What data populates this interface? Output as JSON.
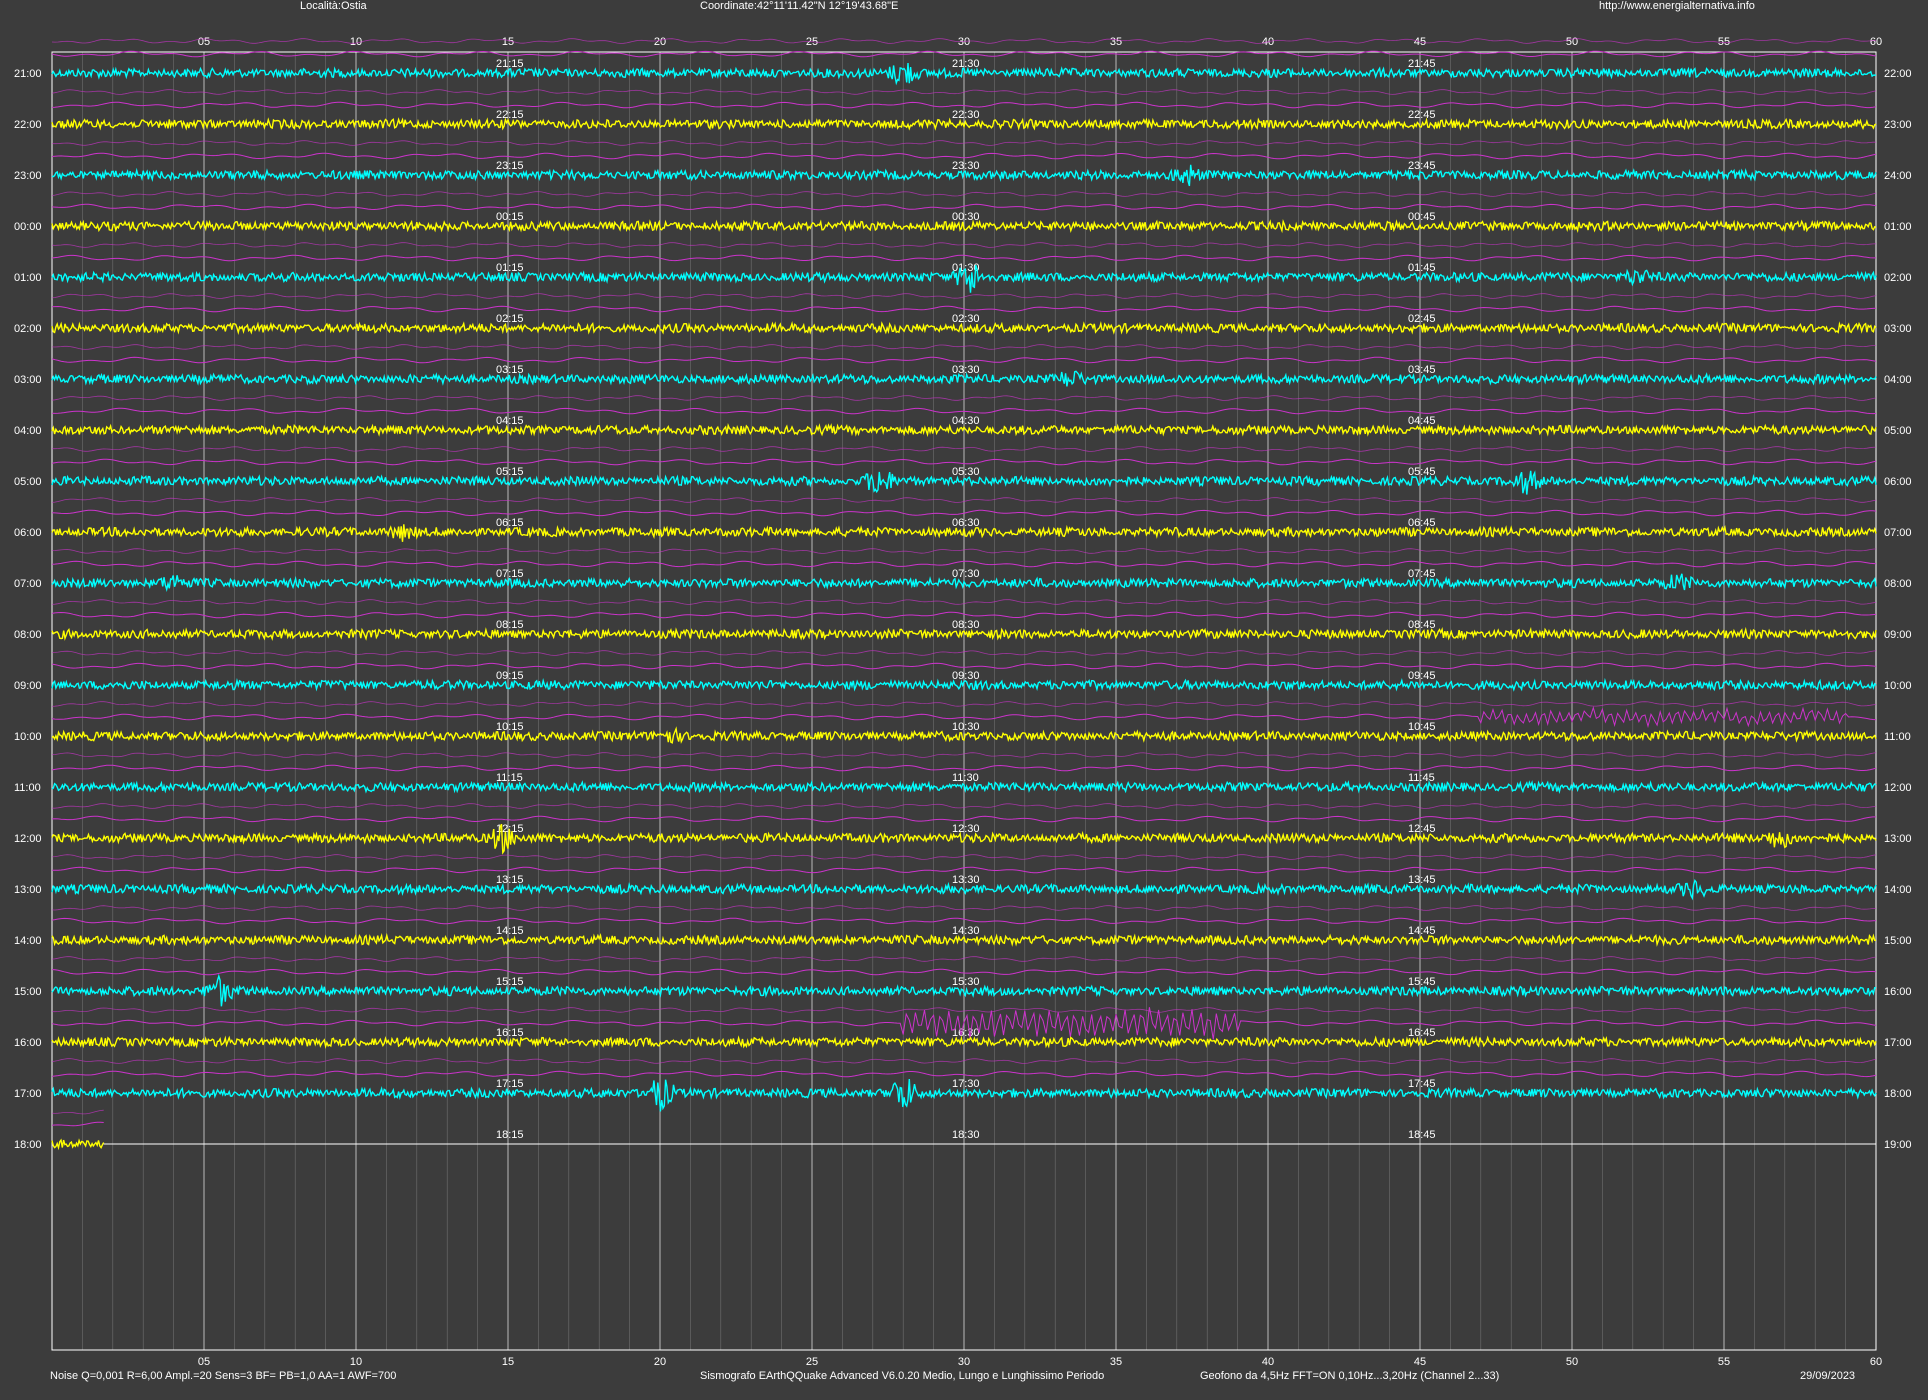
{
  "header": {
    "location": "Località:Ostia",
    "coordinates": "Coordinate:42°11'11.42\"N  12°19'43.68\"E",
    "website": "http://www.energialternativa.info"
  },
  "footer": {
    "settings": "Noise Q=0,001 R=6,00 Ampl.=20 Sens=3 BF= PB=1,0 AA=1 AWF=700",
    "software": "Sismografo  EArthQQuake Advanced V6.0.20  Medio, Lungo e Lunghissimo Periodo",
    "sensor": "Geofono da 4,5Hz FFT=ON 0,10Hz...3,20Hz      (Channel 2...33)",
    "date": "29/09/2023"
  },
  "colors": {
    "background": "#3c3c3c",
    "grid": "#9a9a9a",
    "frame": "#ffffff",
    "trace_a": "#00ffff",
    "trace_b": "#ffff00",
    "long_period": "#cc33cc",
    "text": "#ffffff"
  },
  "chart_data": {
    "type": "line",
    "x_unit": "minutes",
    "xlim": [
      0,
      60
    ],
    "x_ticks": [
      "05",
      "10",
      "15",
      "20",
      "25",
      "30",
      "35",
      "40",
      "45",
      "50",
      "55",
      "60"
    ],
    "grid": true,
    "rows_left_labels": [
      "21:00",
      "22:00",
      "23:00",
      "00:00",
      "01:00",
      "02:00",
      "03:00",
      "04:00",
      "05:00",
      "06:00",
      "07:00",
      "08:00",
      "09:00",
      "10:00",
      "11:00",
      "12:00",
      "13:00",
      "14:00",
      "15:00",
      "16:00",
      "17:00",
      "18:00"
    ],
    "rows_right_labels": [
      "22:00",
      "23:00",
      "24:00",
      "01:00",
      "02:00",
      "03:00",
      "04:00",
      "05:00",
      "06:00",
      "07:00",
      "08:00",
      "09:00",
      "10:00",
      "11:00",
      "12:00",
      "13:00",
      "14:00",
      "15:00",
      "16:00",
      "17:00",
      "18:00",
      "19:00"
    ],
    "quarter_labels": [
      [
        "21:15",
        "21:30",
        "21:45"
      ],
      [
        "22:15",
        "22:30",
        "22:45"
      ],
      [
        "23:15",
        "23:30",
        "23:45"
      ],
      [
        "00:15",
        "00:30",
        "00:45"
      ],
      [
        "01:15",
        "01:30",
        "01:45"
      ],
      [
        "02:15",
        "02:30",
        "02:45"
      ],
      [
        "03:15",
        "03:30",
        "03:45"
      ],
      [
        "04:15",
        "04:30",
        "04:45"
      ],
      [
        "05:15",
        "05:30",
        "05:45"
      ],
      [
        "06:15",
        "06:30",
        "06:45"
      ],
      [
        "07:15",
        "07:30",
        "07:45"
      ],
      [
        "08:15",
        "08:30",
        "08:45"
      ],
      [
        "09:15",
        "09:30",
        "09:45"
      ],
      [
        "10:15",
        "10:30",
        "10:45"
      ],
      [
        "11:15",
        "11:30",
        "11:45"
      ],
      [
        "12:15",
        "12:30",
        "12:45"
      ],
      [
        "13:15",
        "13:30",
        "13:45"
      ],
      [
        "14:15",
        "14:30",
        "14:45"
      ],
      [
        "15:15",
        "15:30",
        "15:45"
      ],
      [
        "16:15",
        "16:30",
        "16:45"
      ],
      [
        "17:15",
        "17:30",
        "17:45"
      ],
      [
        "18:15",
        "18:30",
        "18:45"
      ]
    ],
    "last_row_end_minute": 1.7,
    "events": [
      {
        "row": 0,
        "minute": 28.0,
        "strength": 4
      },
      {
        "row": 2,
        "minute": 37.3,
        "strength": 3
      },
      {
        "row": 4,
        "minute": 30.2,
        "strength": 5
      },
      {
        "row": 4,
        "minute": 52.1,
        "strength": 2
      },
      {
        "row": 6,
        "minute": 33.5,
        "strength": 2
      },
      {
        "row": 8,
        "minute": 27.2,
        "strength": 4
      },
      {
        "row": 8,
        "minute": 48.5,
        "strength": 3
      },
      {
        "row": 9,
        "minute": 11.5,
        "strength": 2
      },
      {
        "row": 10,
        "minute": 4.0,
        "strength": 2
      },
      {
        "row": 10,
        "minute": 53.5,
        "strength": 2
      },
      {
        "row": 13,
        "minute": 20.3,
        "strength": 2
      },
      {
        "row": 15,
        "minute": 14.8,
        "strength": 4
      },
      {
        "row": 15,
        "minute": 56.8,
        "strength": 3
      },
      {
        "row": 16,
        "minute": 54.0,
        "strength": 2
      },
      {
        "row": 18,
        "minute": 5.5,
        "strength": 4
      },
      {
        "row": 20,
        "minute": 20.0,
        "strength": 5
      },
      {
        "row": 20,
        "minute": 28.0,
        "strength": 5
      }
    ],
    "long_period_bursts": [
      {
        "row": 19,
        "from_minute": 28.0,
        "to_minute": 39.0,
        "amplitude": 2
      },
      {
        "row": 13,
        "from_minute": 47.0,
        "to_minute": 59.0,
        "amplitude": 1
      }
    ]
  }
}
